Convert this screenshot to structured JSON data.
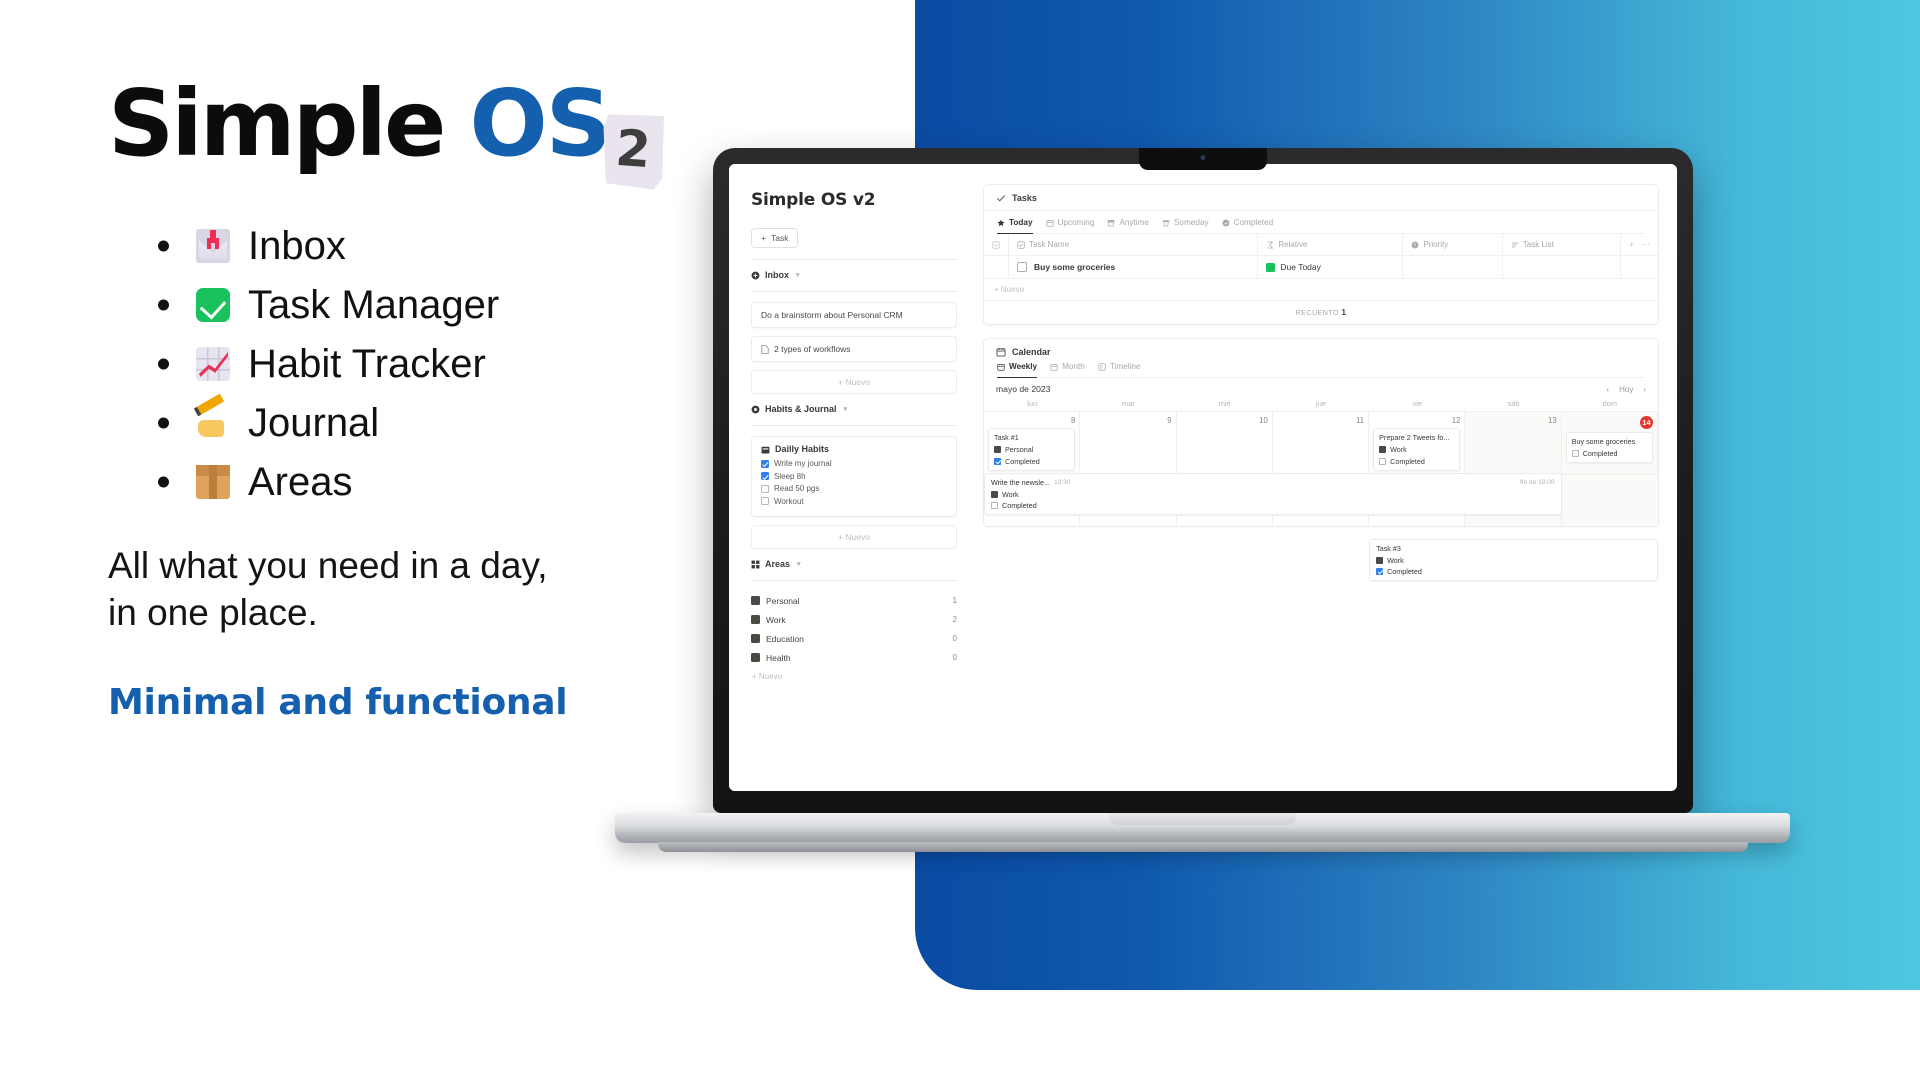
{
  "brand": {
    "word1": "Simple",
    "word2": "OS",
    "badge": "2",
    "accent_color": "#1560ae",
    "black": "#0c0c0c"
  },
  "features": [
    {
      "icon": "inbox-tray-icon",
      "label": "Inbox"
    },
    {
      "icon": "check-mark-icon",
      "label": "Task Manager"
    },
    {
      "icon": "chart-increasing-icon",
      "label": "Habit Tracker"
    },
    {
      "icon": "writing-hand-icon",
      "label": "Journal"
    },
    {
      "icon": "package-icon",
      "label": "Areas"
    }
  ],
  "tagline_line1": "All what you need in a day,",
  "tagline_line2": "in one place.",
  "subtagline": "Minimal and functional",
  "background": {
    "gradient_from": "#0a4ba4",
    "gradient_to": "#4ec8e0"
  },
  "app": {
    "title": "Simple OS v2",
    "sidebar": {
      "new_task_button": "Task",
      "inbox": {
        "title": "Inbox",
        "items": [
          "Do a brainstorm about Personal CRM",
          "2 types of workflows"
        ],
        "add_label": "Nuevo"
      },
      "habits": {
        "title": "Habits & Journal",
        "card_title": "Dailly Habits",
        "items": [
          {
            "label": "Write my journal",
            "checked": true
          },
          {
            "label": "Sleep 8h",
            "checked": true
          },
          {
            "label": "Read 50 pgs",
            "checked": false
          },
          {
            "label": "Workout",
            "checked": false
          }
        ],
        "add_label": "Nuevo"
      },
      "areas": {
        "title": "Areas",
        "items": [
          {
            "label": "Personal",
            "count": "1"
          },
          {
            "label": "Work",
            "count": "2"
          },
          {
            "label": "Education",
            "count": "0"
          },
          {
            "label": "Health",
            "count": "0"
          }
        ],
        "add_label": "Nuevo"
      }
    },
    "tasks_panel": {
      "title": "Tasks",
      "tabs": [
        {
          "label": "Today",
          "icon": "star-icon",
          "active": true
        },
        {
          "label": "Upcoming",
          "icon": "calendar-icon",
          "active": false
        },
        {
          "label": "Anytime",
          "icon": "archive-icon",
          "active": false
        },
        {
          "label": "Someday",
          "icon": "trash-icon",
          "active": false
        },
        {
          "label": "Completed",
          "icon": "check-circle-icon",
          "active": false
        }
      ],
      "columns": [
        "Task Name",
        "Relative",
        "Priority",
        "Task List"
      ],
      "rows": [
        {
          "name": "Buy some groceries",
          "relative": "Due Today",
          "priority": "",
          "task_list": ""
        }
      ],
      "add_label": "Nuevo",
      "count_label": "RECUENTO",
      "count_value": "1"
    },
    "calendar_panel": {
      "title": "Calendar",
      "tabs": [
        {
          "label": "Weekly",
          "active": true
        },
        {
          "label": "Month",
          "active": false
        },
        {
          "label": "Timeline",
          "active": false
        }
      ],
      "month_label": "mayo de 2023",
      "today_label": "Hoy",
      "day_names": [
        "lun",
        "mar",
        "mié",
        "jue",
        "vie",
        "sáb",
        "dom"
      ],
      "days": [
        {
          "num": "8",
          "today": false
        },
        {
          "num": "9",
          "today": false
        },
        {
          "num": "10",
          "today": false
        },
        {
          "num": "11",
          "today": false
        },
        {
          "num": "12",
          "today": false
        },
        {
          "num": "13",
          "today": false,
          "shade": true
        },
        {
          "num": "14",
          "today": true
        }
      ],
      "events": [
        {
          "day": 0,
          "title": "Task #1",
          "area": "Personal",
          "status": "Completed",
          "done": true
        },
        {
          "day": 4,
          "title": "Prepare 2 Tweets fo...",
          "area": "Work",
          "status": "Completed",
          "done": false
        },
        {
          "day": 6,
          "title": "Buy some groceries",
          "area": "",
          "status": "Completed",
          "done": false
        }
      ],
      "span_event": {
        "title": "Write the newsle...",
        "time": "13:30",
        "end_time": "fin de 18:00",
        "area": "Work",
        "status": "Completed",
        "done": false
      },
      "span_event2": {
        "title": "Task #3",
        "area": "Work",
        "status": "Completed",
        "done": true
      }
    }
  }
}
